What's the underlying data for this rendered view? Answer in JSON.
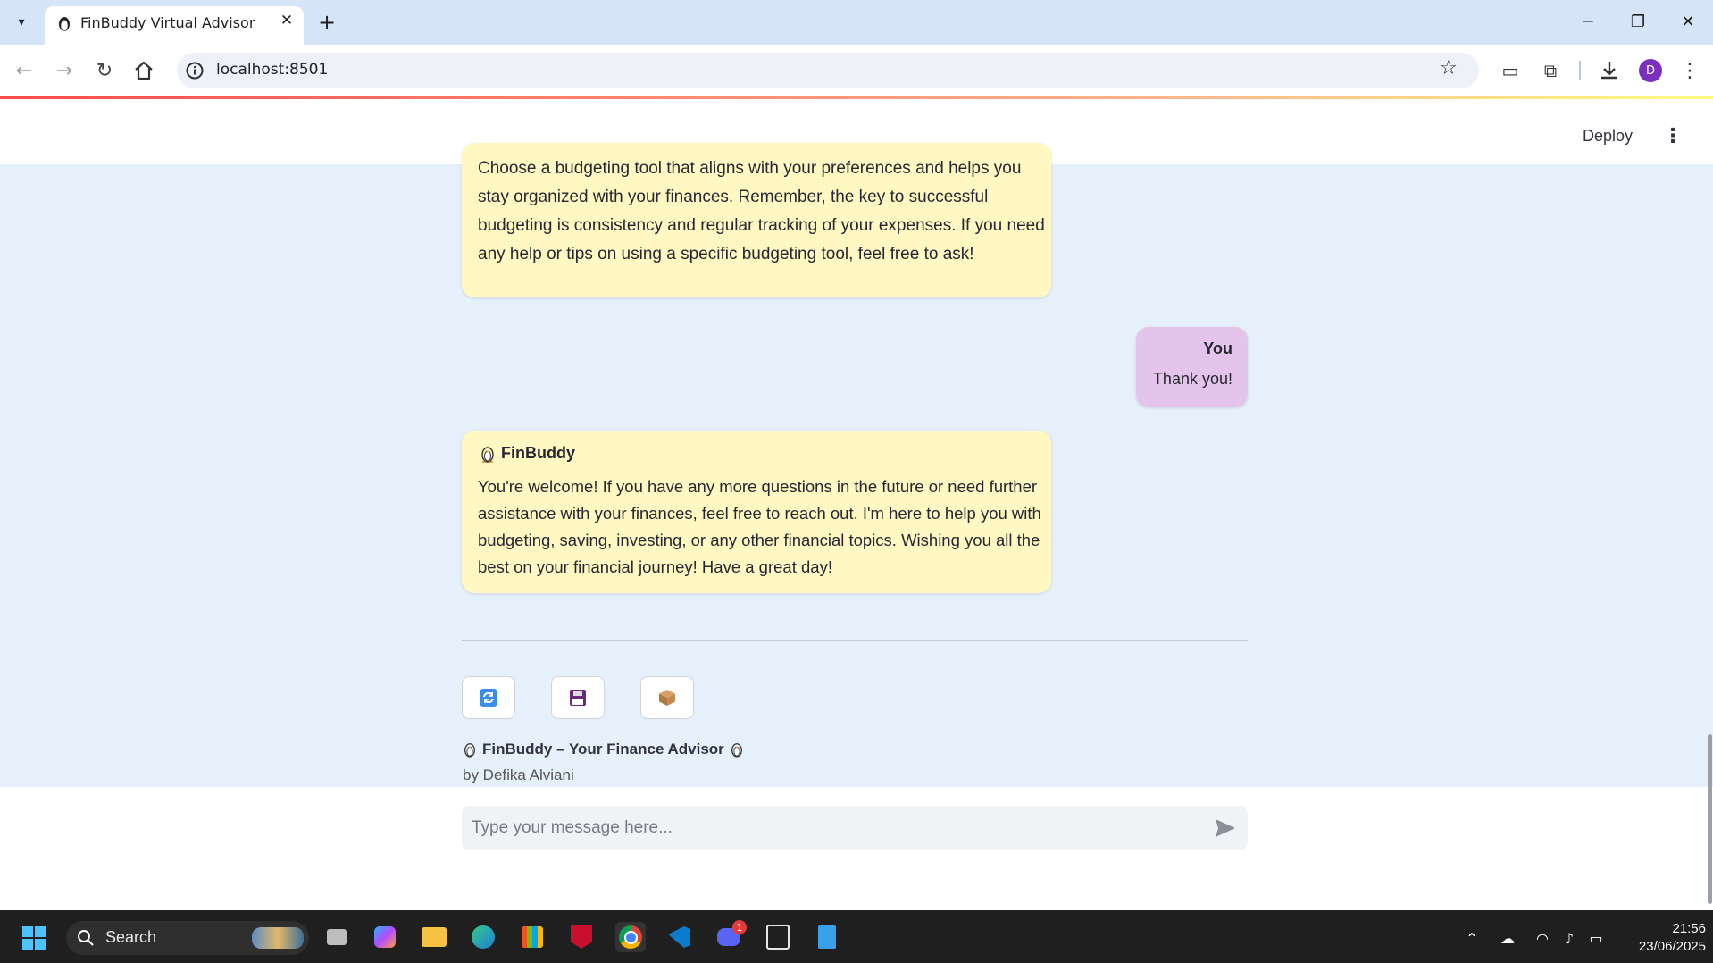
{
  "browser": {
    "tab_title": "FinBuddy Virtual Advisor",
    "url": "localhost:8501",
    "profile_initial": "D"
  },
  "app": {
    "deploy_label": "Deploy",
    "messages": [
      {
        "role": "assistant",
        "text": "Choose a budgeting tool that aligns with your preferences and helps you stay organized with your finances. Remember, the key to successful budgeting is consistency and regular tracking of your expenses. If you need any help or tips on using a specific budgeting tool, feel free to ask!"
      },
      {
        "role": "user",
        "sender": "You",
        "text": "Thank you!"
      },
      {
        "role": "assistant",
        "sender": "FinBuddy",
        "text": "You're welcome! If you have any more questions in the future or need further assistance with your finances, feel free to reach out. I'm here to help you with budgeting, saving, investing, or any other financial topics. Wishing you all the best on your financial journey! Have a great day!"
      }
    ],
    "footer": {
      "title": "FinBuddy – Your Finance Advisor",
      "author": "by Defika Alviani"
    },
    "chat_input": {
      "placeholder": "Type your message here..."
    },
    "colors": {
      "main_bg": "#e6f0fb",
      "bot_bubble": "#fff8c2",
      "user_bubble": "#e5c4eb"
    }
  },
  "taskbar": {
    "search_label": "Search",
    "time": "21:56",
    "date": "23/06/2025",
    "discord_badge": "1"
  }
}
